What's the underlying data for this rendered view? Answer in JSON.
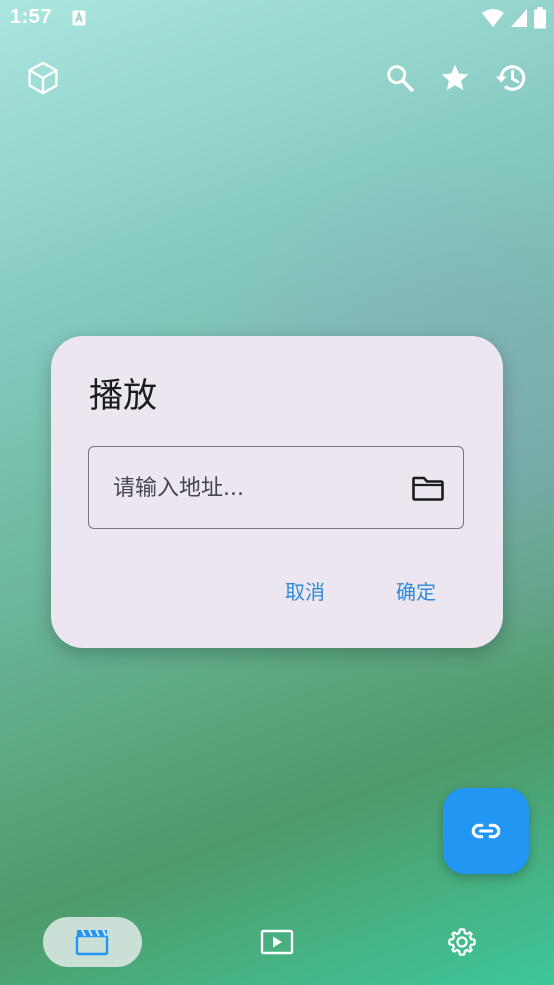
{
  "status_bar": {
    "time": "1:57"
  },
  "toolbar": {
    "app_icon": "cube-icon",
    "icons": [
      "search-icon",
      "star-icon",
      "history-icon"
    ]
  },
  "dialog": {
    "title": "播放",
    "input": {
      "placeholder": "请输入地址...",
      "value": ""
    },
    "folder_icon": "folder-icon",
    "cancel_label": "取消",
    "confirm_label": "确定"
  },
  "fab": {
    "icon": "link-icon"
  },
  "bottom_nav": {
    "items": [
      {
        "icon": "movie-clapper-icon",
        "selected": true
      },
      {
        "icon": "play-video-icon",
        "selected": false
      },
      {
        "icon": "settings-gear-icon",
        "selected": false
      }
    ]
  },
  "colors": {
    "accent": "#2196f3",
    "dialog_bg": "#ebe6f0",
    "button_text": "#2e8bd8",
    "nav_selected_pill": "#dce8e4"
  }
}
